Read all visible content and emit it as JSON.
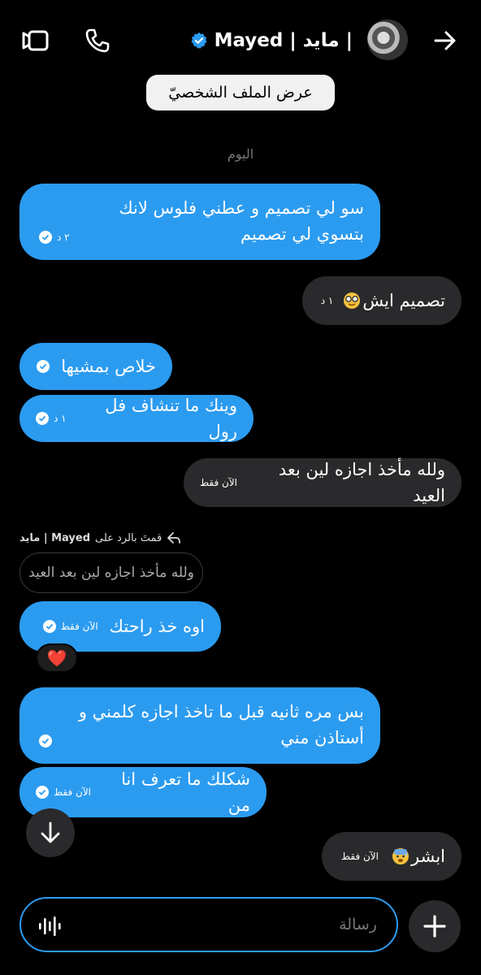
{
  "header": {
    "title": "Mayed | مايد |",
    "verified": true,
    "icons": [
      "video-icon",
      "phone-icon",
      "verified-badge-icon",
      "arrow-right-icon"
    ]
  },
  "profile_button": "عرض الملف الشخصيّ",
  "date_separator": "اليوم",
  "messages": [
    {
      "side": "me",
      "text": "سو لي تصميم و عطني فلوس لانك بتسوي لي تصميم",
      "time": "٢ د",
      "seen": true
    },
    {
      "side": "them",
      "text": "تصميم ايش",
      "emoji": "nerd-face-emoji",
      "time": "١ د"
    },
    {
      "side": "me",
      "text": "خلاص بمشيها",
      "time": "",
      "seen": true
    },
    {
      "side": "me",
      "text": "وينك ما تنشاف فل رول",
      "time": "١ د",
      "seen": true
    },
    {
      "side": "them",
      "text": "ولله مأخذ اجازه لين بعد العيد",
      "time": "الآن فقط"
    },
    {
      "side": "me",
      "text": "اوه خذ راحتك",
      "time": "الآن فقط",
      "seen": true
    },
    {
      "side": "me",
      "text": "بس مره ثانيه قبل ما تاخذ اجازه كلمني و أستاذن مني",
      "time": "",
      "seen": true
    },
    {
      "side": "me",
      "text": "شكلك ما تعرف انا من",
      "time": "الآن فقط",
      "seen": true
    },
    {
      "side": "them",
      "text": "ابشر",
      "emoji": "anxious-face-emoji",
      "time": "الآن فقط"
    }
  ],
  "reply": {
    "label": "قمتَ بالرد على",
    "name": "Mayed | مايد",
    "quoted_text": "ولله مأخذ اجازه لين بعد العيد"
  },
  "reaction": "❤️",
  "composer": {
    "placeholder": "رسالة",
    "value": ""
  },
  "colors": {
    "background": "#000000",
    "sent_bubble": "#2b9bf0",
    "received_bubble": "#2a2a2c",
    "accent": "#2b9bf0"
  }
}
